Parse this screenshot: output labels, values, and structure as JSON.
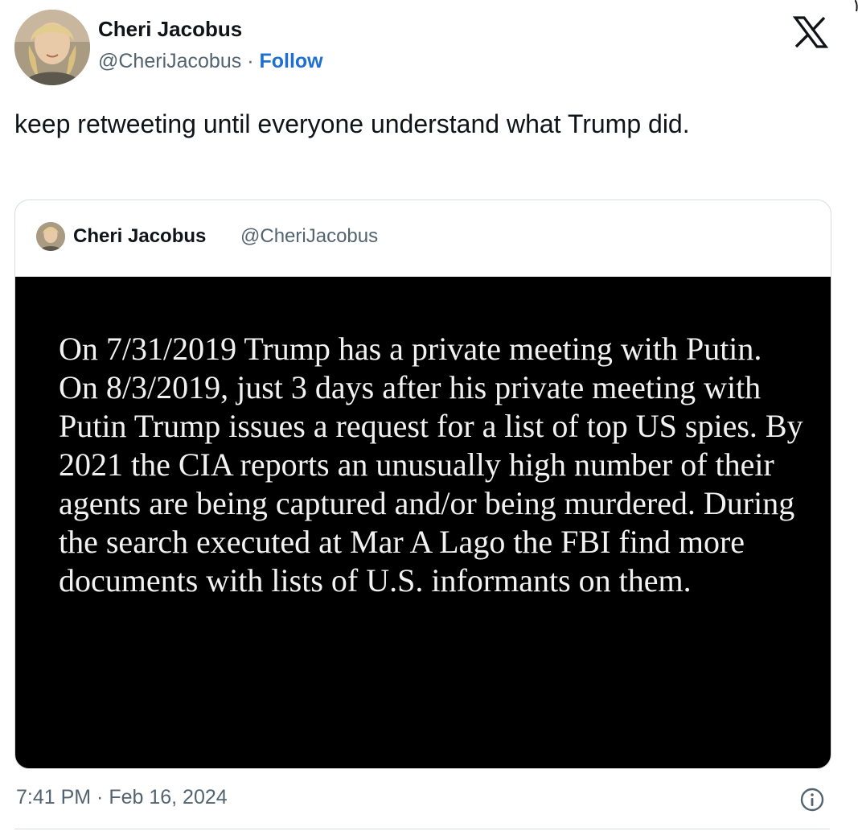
{
  "author": {
    "name": "Cheri Jacobus",
    "handle": "@CheriJacobus",
    "separator": " · ",
    "follow_label": "Follow"
  },
  "tweet": {
    "text": "keep retweeting until everyone understand what Trump did."
  },
  "quoted_tweet": {
    "name": "Cheri Jacobus",
    "handle": "@CheriJacobus",
    "image_text": "On  7/31/2019 Trump has a private meeting with Putin. On 8/3/2019, just 3 days after his private meeting with Putin Trump issues a request for a list of top US spies. By 2021 the CIA reports an unusually high number of their agents are being captured and/or being murdered.  During the search executed at Mar A Lago the FBI find more documents with lists of U.S. informants on them."
  },
  "timestamp": "7:41 PM · Feb 16, 2024",
  "icons": {
    "brand": "x-logo-icon",
    "info": "info-icon"
  },
  "colors": {
    "text_primary": "#0f1419",
    "text_secondary": "#536471",
    "follow": "#1d6fd1",
    "quote_image_bg": "#000000"
  }
}
